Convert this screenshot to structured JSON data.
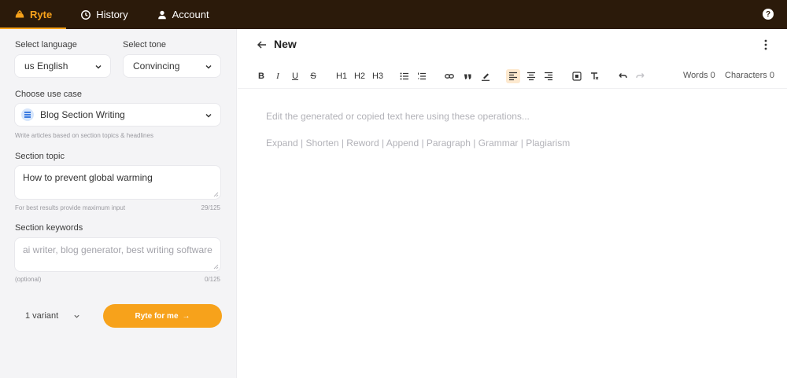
{
  "nav": {
    "tabs": [
      {
        "label": "Ryte",
        "icon": "ryte-logo-icon"
      },
      {
        "label": "History",
        "icon": "history-icon"
      },
      {
        "label": "Account",
        "icon": "account-icon"
      }
    ],
    "help_icon": "?"
  },
  "sidebar": {
    "language_label": "Select language",
    "language_value": "us English",
    "tone_label": "Select tone",
    "tone_value": "Convincing",
    "use_case_label": "Choose use case",
    "use_case_value": "Blog Section Writing",
    "use_case_hint": "Write articles based on section topics & headlines",
    "topic_label": "Section topic",
    "topic_value": "How to prevent global warming",
    "topic_hint": "For best results provide maximum input",
    "topic_count": "29/125",
    "keywords_label": "Section keywords",
    "keywords_placeholder": "ai writer, blog generator, best writing software",
    "keywords_hint": "(optional)",
    "keywords_count": "0/125",
    "variant_value": "1 variant",
    "ryte_button": "Ryte for me",
    "ryte_button_arrow": "→"
  },
  "editor": {
    "title": "New",
    "toolbar": {
      "bold": "B",
      "italic": "I",
      "underline": "U",
      "strike": "S",
      "h1": "H1",
      "h2": "H2",
      "h3": "H3",
      "words": "Words 0",
      "characters": "Characters 0"
    },
    "placeholder_line1": "Edit the generated or copied text here using these operations...",
    "placeholder_line2": "Expand | Shorten | Reword | Append | Paragraph | Grammar | Plagiarism"
  },
  "colors": {
    "nav_bg": "#2b1a0a",
    "accent": "#f7a21b",
    "sidebar_bg": "#f4f4f6"
  }
}
